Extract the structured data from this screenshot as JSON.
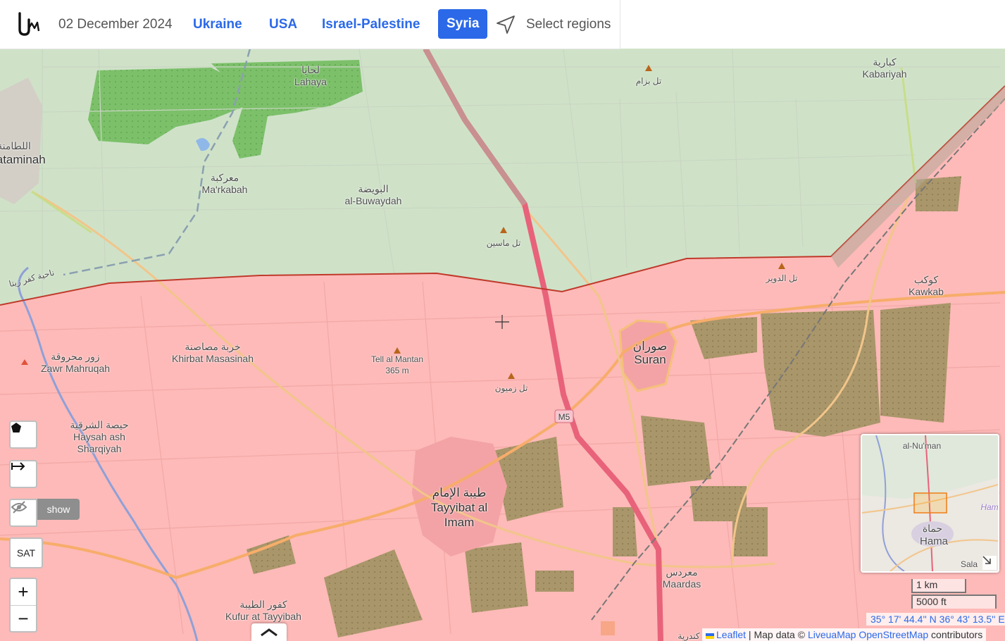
{
  "header": {
    "date": "02 December 2024",
    "tabs": [
      {
        "label": "Ukraine"
      },
      {
        "label": "USA"
      },
      {
        "label": "Israel-Palestine"
      },
      {
        "label": "Syria",
        "active": true
      }
    ],
    "select_regions": "Select regions"
  },
  "map": {
    "labels": {
      "lahaya_ar": "لحايا",
      "lahaya": "Lahaya",
      "kabariyah_ar": "كبارية",
      "kabariyah": "Kabariyah",
      "tal_bazam": "تل بزام",
      "lataminah_ar": "اللطامنة",
      "lataminah": "Lataminah",
      "markabah_ar": "معركبة",
      "markabah": "Ma'rkabah",
      "buwaydah_ar": "البويضة",
      "buwaydah": "al-Buwaydah",
      "tal_masin": "تل ماسين",
      "kafr_zita_ar": "ناحية كفر زيتا",
      "tal_dwayr": "تل الدوير",
      "kawkab_ar": "كوكب",
      "kawkab": "Kawkab",
      "zawr_ar": "زور محروقة",
      "zawr": "Zawr Mahruqah",
      "khirbat_ar": "خربة مصاصنة",
      "khirbat": "Khirbat Masasinah",
      "tell_mantan": "Tell al Mantan",
      "tell_mantan_elev": "365 m",
      "tal_zamyoun": "تل زميون",
      "suran_ar": "صوران",
      "suran": "Suran",
      "haysah_ar": "حيصة الشرقية",
      "haysah1": "Haysah ash",
      "haysah2": "Sharqiyah",
      "m5": "M5",
      "tayyibat_ar": "طيبة الإمام",
      "tayyibat1": "Tayyibat al",
      "tayyibat2": "Imam",
      "maardas_ar": "معردس",
      "maardas": "Maardas",
      "kufur_ar": "كفور الطيبة",
      "kufur": "Kufur at Tayyibah",
      "kandariyah_ar": "كندرية"
    },
    "controls": {
      "show_label": "show",
      "sat_label": "SAT",
      "zoom_in": "+",
      "zoom_out": "−"
    },
    "minimap": {
      "label_numan": "al-Nu'man",
      "label_hama_ar": "حماة",
      "label_hama": "Hama",
      "label_ham": "Ham",
      "label_sala": "Sala"
    },
    "scale": {
      "metric": "1 km",
      "imperial": "5000 ft"
    },
    "coordinates": "35° 17' 44.4'' N 36° 43' 13.5'' E",
    "attribution": {
      "leaflet": "Leaflet",
      "sep": " | Map data © ",
      "liveuamap": "LiveuaMap",
      "osm": "OpenStreetMap",
      "contributors": " contributors"
    },
    "colors": {
      "opposition_zone": "#cfe2c8",
      "government_zone": "#fdbab8",
      "frontline": "#c0392b",
      "accent": "#2b69e9"
    }
  }
}
